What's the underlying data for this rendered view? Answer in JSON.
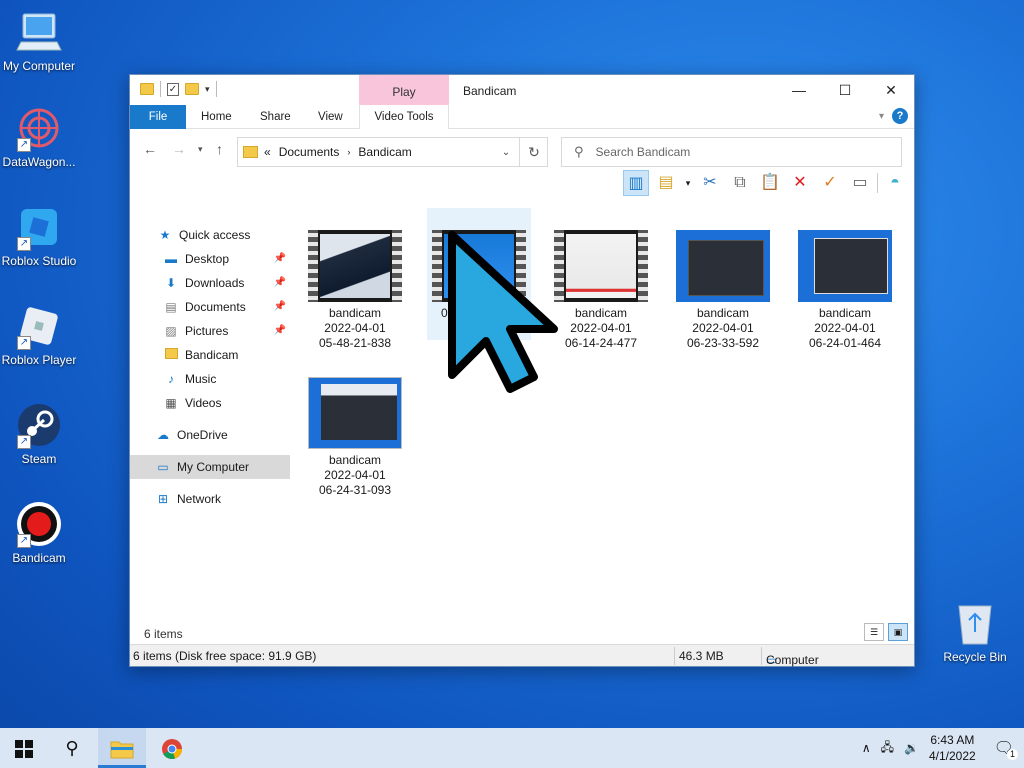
{
  "desktop": {
    "icons": [
      {
        "label": "My Computer"
      },
      {
        "label": "DataWagon..."
      },
      {
        "label": "Roblox Studio"
      },
      {
        "label": "Roblox Player"
      },
      {
        "label": "Steam"
      },
      {
        "label": "Bandicam"
      }
    ],
    "recycle_bin": "Recycle Bin"
  },
  "window": {
    "title": "Bandicam",
    "context_tab_group": "Play",
    "ribbon_tabs": [
      "File",
      "Home",
      "Share",
      "View",
      "Video Tools"
    ],
    "help": "?",
    "address": {
      "overflow": "«",
      "crumbs": [
        "Documents",
        "Bandicam"
      ]
    },
    "search_placeholder": "Search Bandicam",
    "nav": {
      "quick_access": "Quick access",
      "items": [
        "Desktop",
        "Downloads",
        "Documents",
        "Pictures",
        "Bandicam",
        "Music",
        "Videos"
      ],
      "onedrive": "OneDrive",
      "my_computer": "My Computer",
      "network": "Network"
    },
    "files": [
      {
        "name": "bandicam",
        "date": "2022-04-01",
        "time": "05-48-21-838"
      },
      {
        "name": "",
        "date": "",
        "time": "0"
      },
      {
        "name": "bandicam",
        "date": "2022-04-01",
        "time": "06-14-24-477"
      },
      {
        "name": "bandicam",
        "date": "2022-04-01",
        "time": "06-23-33-592"
      },
      {
        "name": "bandicam",
        "date": "2022-04-01",
        "time": "06-24-01-464"
      },
      {
        "name": "bandicam",
        "date": "2022-04-01",
        "time": "06-24-31-093"
      }
    ],
    "item_count": "6 items",
    "status": {
      "left": "6 items (Disk free space: 91.9 GB)",
      "size": "46.3 MB",
      "location": "Computer"
    }
  },
  "taskbar": {
    "time": "6:43 AM",
    "date": "4/1/2022",
    "notification_count": "1"
  }
}
